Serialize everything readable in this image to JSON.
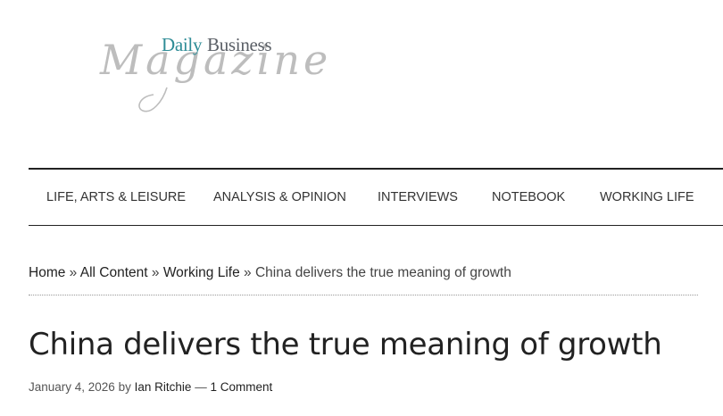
{
  "logo": {
    "daily": "Daily",
    "business": "Business",
    "magazine": "Magazine"
  },
  "nav": {
    "items": [
      {
        "label": "LIFE, ARTS & LEISURE"
      },
      {
        "label": "ANALYSIS & OPINION"
      },
      {
        "label": "INTERVIEWS"
      },
      {
        "label": "NOTEBOOK"
      },
      {
        "label": "WORKING LIFE"
      }
    ]
  },
  "breadcrumb": {
    "home": "Home",
    "all_content": "All Content",
    "working_life": "Working Life",
    "current": "China delivers the true meaning of growth",
    "separator": "»"
  },
  "article": {
    "title": "China delivers the true meaning of growth",
    "date": "January 4, 2026",
    "by": "by",
    "author": "Ian Ritchie",
    "dash": "—",
    "comments": "1 Comment"
  },
  "colors": {
    "brand_teal": "#2e8c96",
    "logo_grey": "#bdbdbd",
    "text": "#222222"
  }
}
